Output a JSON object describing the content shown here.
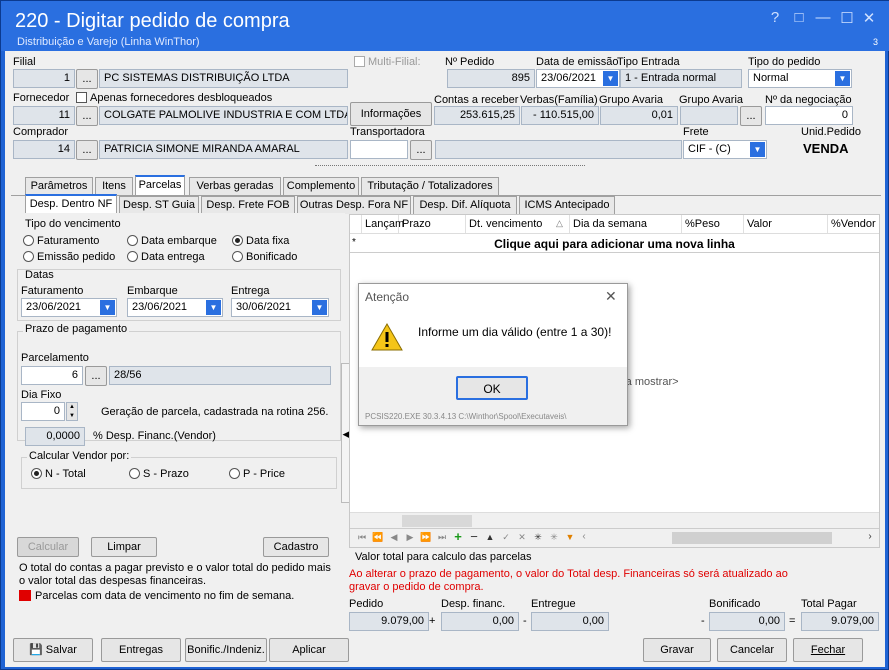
{
  "window": {
    "title": "220 - Digitar pedido de compra",
    "subtitle": "Distribuição e Varejo (Linha WinThor)",
    "help": "?",
    "restore": "□",
    "minimize": "—",
    "maximize": "☐",
    "close": "✕",
    "counter": "3"
  },
  "header": {
    "filial_label": "Filial",
    "filial_code": "1",
    "ellipsis": "...",
    "filial_name": "PC SISTEMAS DISTRIBUIÇÃO LTDA",
    "multi_filial": "Multi-Filial:",
    "npedido_label": "Nº Pedido",
    "npedido": "895",
    "data_emissao_label": "Data de emissão",
    "data_emissao": "23/06/2021",
    "tipo_entrada_label": "Tipo Entrada",
    "tipo_entrada": "1 - Entrada normal",
    "tipo_pedido_label": "Tipo do pedido",
    "tipo_pedido": "Normal",
    "fornecedor_label": "Fornecedor",
    "apenas_label": "Apenas fornecedores desbloqueados",
    "fornecedor_code": "11",
    "fornecedor_name": "COLGATE PALMOLIVE INDUSTRIA  E COM LTDA",
    "informacoes": "Informações",
    "contas_label": "Contas a receber",
    "contas": "253.615,25",
    "verbas_label": "Verbas(Família)",
    "verbas": "- 110.515,00",
    "grupo_avaria_label": "Grupo Avaria",
    "grupo_avaria": "0,01",
    "grupo_avaria2_label": "Grupo Avaria",
    "negociacao_label": "Nº da negociação",
    "negociacao": "0",
    "comprador_label": "Comprador",
    "comprador_code": "14",
    "comprador_name": "PATRICIA SIMONE MIRANDA AMARAL",
    "transportadora_label": "Transportadora",
    "frete_label": "Frete",
    "frete": "CIF - (C)",
    "unid_label": "Unid.Pedido",
    "unid": "VENDA"
  },
  "tabs": [
    "Parâmetros",
    "Itens",
    "Parcelas",
    "Verbas geradas",
    "Complemento",
    "Tributação / Totalizadores"
  ],
  "subtabs": [
    "Desp. Dentro NF",
    "Desp. ST Guia",
    "Desp. Frete FOB",
    "Outras Desp. Fora NF",
    "Desp. Dif. Alíquota",
    "ICMS Antecipado"
  ],
  "left": {
    "tipo_venc_label": "Tipo do vencimento",
    "radios": [
      "Faturamento",
      "Data embarque",
      "Data fixa",
      "Emissão pedido",
      "Data entrega",
      "Bonificado"
    ],
    "datas_label": "Datas",
    "faturamento_label": "Faturamento",
    "faturamento": "23/06/2021",
    "embarque_label": "Embarque",
    "embarque": "23/06/2021",
    "entrega_label": "Entrega",
    "entrega": "30/06/2021",
    "prazo_label": "Prazo de pagamento",
    "parcelamento_label": "Parcelamento",
    "parcelamento": "6",
    "parcelamento_desc": "28/56",
    "dia_fixo_label": "Dia Fixo",
    "dia_fixo": "0",
    "geracao_text": "Geração de parcela, cadastrada na rotina 256.",
    "desp_financ": "0,0000",
    "desp_financ_label": "% Desp. Financ.(Vendor)",
    "calc_vendor_label": "Calcular Vendor por:",
    "vendor_opts": [
      "N - Total",
      "S - Prazo",
      "P - Price"
    ],
    "calcular": "Calcular",
    "limpar": "Limpar",
    "cadastro": "Cadastro",
    "info_text": "O total do contas a pagar previsto e o valor total do pedido mais o valor total das despesas financeiras.",
    "legend_text": "Parcelas com data de vencimento no fim de semana.",
    "legend_color": "#e00000"
  },
  "grid": {
    "columns": [
      "Lançam",
      "Prazo",
      "Dt. vencimento",
      "Dia da semana",
      "%Peso",
      "Valor",
      "%Vendor"
    ],
    "add_row": "Clique aqui para adicionar uma nova linha",
    "empty_text": "ra mostrar>"
  },
  "totals": {
    "title": "Valor total para calculo das parcelas",
    "warning": "Ao alterar o prazo de pagamento, o valor do Total desp. Financeiras só será atualizado ao gravar o pedido de compra.",
    "pedido_label": "Pedido",
    "pedido": "9.079,00",
    "desp_label": "Desp. financ.",
    "desp": "0,00",
    "entregue_label": "Entregue",
    "entregue": "0,00",
    "bonificado_label": "Bonificado",
    "bonificado": "0,00",
    "total_label": "Total Pagar",
    "total": "9.079,00",
    "plus": "+",
    "minus": "-",
    "equals": "="
  },
  "footer": {
    "salvar": "Salvar",
    "entregas": "Entregas",
    "bonific": "Bonific./Indeniz.",
    "aplicar": "Aplicar",
    "gravar": "Gravar",
    "cancelar": "Cancelar",
    "fechar": "Fechar"
  },
  "dialog": {
    "title": "Atenção",
    "message": "Informe um dia válido (entre 1 a 30)!",
    "ok": "OK",
    "status": "PCSIS220.EXE 30.3.4.13 C:\\Winthor\\Spool\\Executaveis\\"
  }
}
